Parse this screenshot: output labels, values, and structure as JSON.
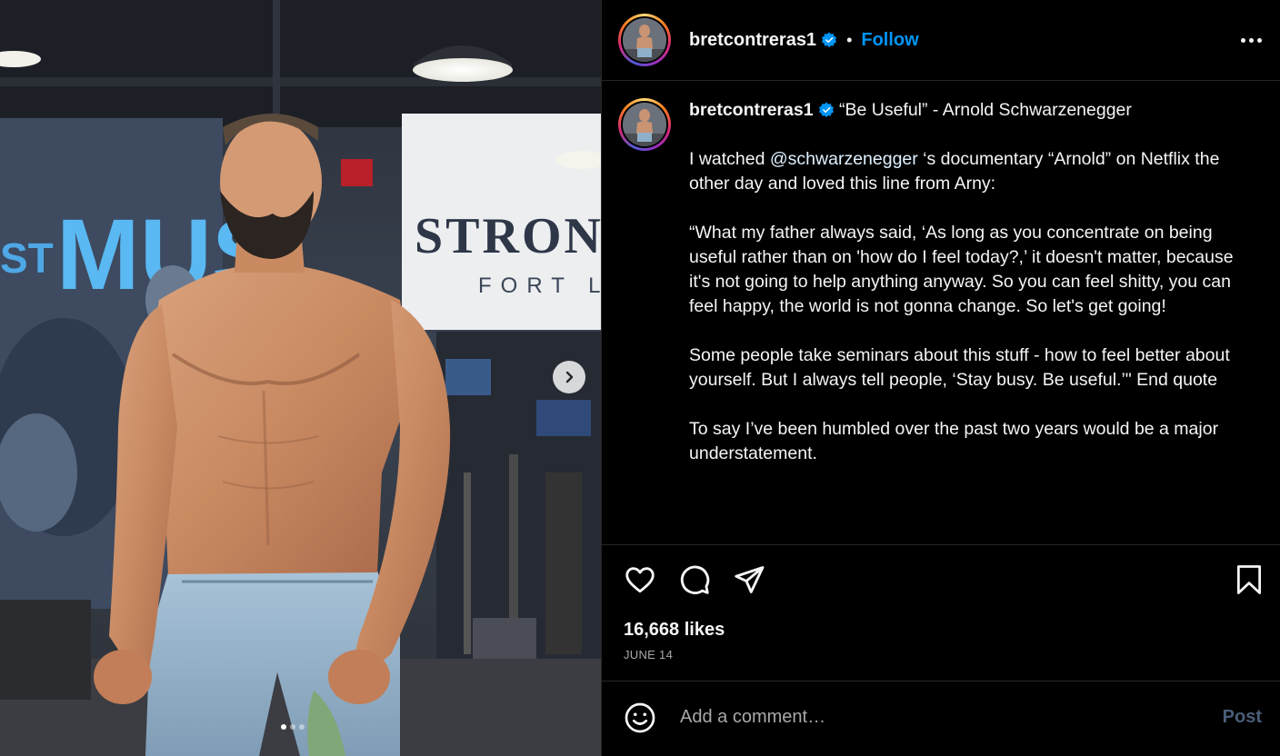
{
  "colors": {
    "background": "#000000",
    "text": "#f5f5f5",
    "follow_blue": "#0095f6",
    "muted": "#a8a8a8",
    "post_disabled": "#4a5d78",
    "divider": "#262626"
  },
  "header": {
    "username": "bretcontreras1",
    "bullet": "•",
    "follow_label": "Follow",
    "more_icon": "more-horizontal-icon"
  },
  "media": {
    "photo": "shirtless bearded man in light-blue jeans standing in a gym",
    "background_signs": {
      "left": "MUS",
      "left_small": "ST",
      "banner_main": "STRON",
      "banner_sub": "FORT L"
    },
    "next_icon": "chevron-right-icon",
    "carousel_total": 3,
    "carousel_active": 1
  },
  "caption": {
    "username": "bretcontreras1",
    "headline": "“Be Useful” - Arnold Schwarzenegger",
    "p1_before": "I watched ",
    "p1_mention": "@schwarzenegger",
    "p1_after": " ‘s documentary “Arnold” on Netflix the other day and loved this line from Arny:",
    "p2": "“What my father always said, ‘As long as you concentrate on being useful rather than on 'how do I feel today?,’ it doesn't matter, because it's not going to help anything anyway. So you can feel shitty, you can feel happy, the world is not gonna change. So let's get going!",
    "p3": "Some people take seminars about this stuff - how to feel better about yourself. But I always tell people, ‘Stay busy. Be useful.’\" End quote",
    "p4": "To say I’ve been humbled over the past two years would be a major understatement."
  },
  "actions": {
    "like_icon": "heart-icon",
    "comment_icon": "comment-icon",
    "share_icon": "send-icon",
    "save_icon": "bookmark-icon"
  },
  "likes_text": "16,668 likes",
  "date_text": "JUNE 14",
  "comment": {
    "emoji_icon": "emoji-icon",
    "placeholder": "Add a comment…",
    "post_label": "Post"
  }
}
